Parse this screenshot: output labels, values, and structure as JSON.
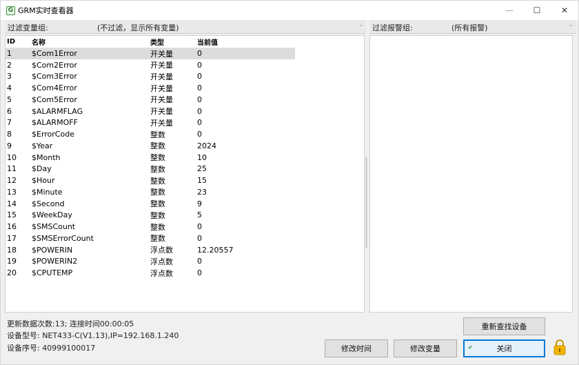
{
  "window": {
    "title": "GRM实时查看器",
    "icon": "grm-app-icon",
    "controls": {
      "minimize": "—",
      "maximize": "☐",
      "close": "✕"
    }
  },
  "variable_filter": {
    "label": "过滤变量组:",
    "value": "(不过滤，显示所有变量)"
  },
  "alarm_filter": {
    "label": "过滤报警组:",
    "value": "(所有报警)"
  },
  "table": {
    "columns": [
      "ID",
      "名称",
      "类型",
      "当前值"
    ],
    "rows": [
      [
        "1",
        "$Com1Error",
        "开关量",
        "0"
      ],
      [
        "2",
        "$Com2Error",
        "开关量",
        "0"
      ],
      [
        "3",
        "$Com3Error",
        "开关量",
        "0"
      ],
      [
        "4",
        "$Com4Error",
        "开关量",
        "0"
      ],
      [
        "5",
        "$Com5Error",
        "开关量",
        "0"
      ],
      [
        "6",
        "$ALARMFLAG",
        "开关量",
        "0"
      ],
      [
        "7",
        "$ALARMOFF",
        "开关量",
        "0"
      ],
      [
        "8",
        "$ErrorCode",
        "整数",
        "0"
      ],
      [
        "9",
        "$Year",
        "整数",
        "2024"
      ],
      [
        "10",
        "$Month",
        "整数",
        "10"
      ],
      [
        "11",
        "$Day",
        "整数",
        "25"
      ],
      [
        "12",
        "$Hour",
        "整数",
        "15"
      ],
      [
        "13",
        "$Minute",
        "整数",
        "23"
      ],
      [
        "14",
        "$Second",
        "整数",
        "9"
      ],
      [
        "15",
        "$WeekDay",
        "整数",
        "5"
      ],
      [
        "16",
        "$SMSCount",
        "整数",
        "0"
      ],
      [
        "17",
        "$SMSErrorCount",
        "整数",
        "0"
      ],
      [
        "18",
        "$POWERIN",
        "浮点数",
        "12.20557"
      ],
      [
        "19",
        "$POWERIN2",
        "浮点数",
        "0"
      ],
      [
        "20",
        "$CPUTEMP",
        "浮点数",
        "0"
      ]
    ]
  },
  "status": {
    "line1": "更新数据次数:13; 连接时间00:00:05",
    "line2": "设备型号: NET433-C(V1.13),IP=192.168.1.240",
    "line3": "设备序号: 40999100017"
  },
  "buttons": {
    "research": "重新查找设备",
    "modify_time": "修改时间",
    "modify_var": "修改变量",
    "close": "关闭"
  },
  "colors": {
    "selected_row": "#dcdcdc",
    "lock": "#f0b400",
    "default_button_border": "#0078d7"
  }
}
